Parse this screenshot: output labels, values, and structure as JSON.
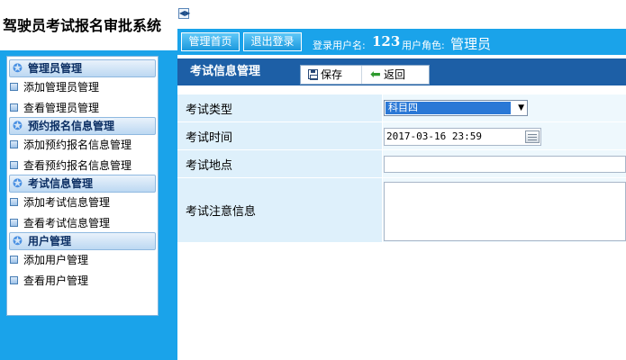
{
  "app": {
    "title": "驾驶员考试报名审批系统"
  },
  "nav": {
    "tabs": [
      "管理首页",
      "退出登录"
    ],
    "login_label": "登录用户名:",
    "login_user": "123",
    "role_label": "用户角色:",
    "role_value": "管理员"
  },
  "sidebar": {
    "groups": [
      {
        "title": "管理员管理",
        "items": [
          "添加管理员管理",
          "查看管理员管理"
        ]
      },
      {
        "title": "预约报名信息管理",
        "items": [
          "添加预约报名信息管理",
          "查看预约报名信息管理"
        ]
      },
      {
        "title": "考试信息管理",
        "items": [
          "添加考试信息管理",
          "查看考试信息管理"
        ]
      },
      {
        "title": "用户管理",
        "items": [
          "添加用户管理",
          "查看用户管理"
        ]
      }
    ]
  },
  "main": {
    "title": "考试信息管理",
    "toolbar": {
      "save_label": "保存",
      "back_label": "返回"
    },
    "form": {
      "type_label": "考试类型",
      "type_value": "科目四",
      "time_label": "考试时间",
      "time_value": "2017-03-16 23:59",
      "location_label": "考试地点",
      "location_value": "",
      "notes_label": "考试注意信息",
      "notes_value": ""
    }
  },
  "colors": {
    "sidebar_bg": "#1aa3ea",
    "header_bar": "#1d5fa6",
    "label_cell": "#def0fb",
    "selected": "#2a78d6"
  },
  "icons": [
    "star-icon",
    "square-bullet-icon",
    "collapse-arrow-icon",
    "save-icon",
    "back-arrow-icon",
    "calendar-icon",
    "dropdown-arrow-icon"
  ]
}
